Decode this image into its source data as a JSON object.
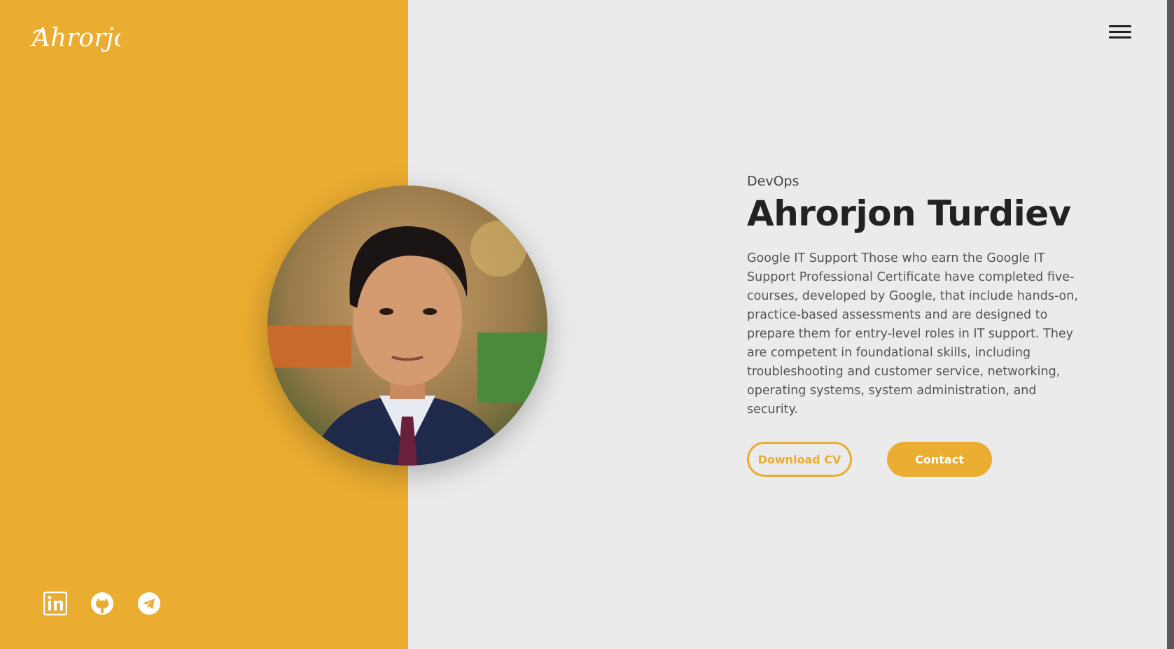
{
  "brand": {
    "logo_text": "Ahrorjon",
    "accent_color": "#eaac31",
    "background_color": "#ebebeb"
  },
  "nav": {
    "menu_icon": "hamburger-menu-icon"
  },
  "hero": {
    "role": "DevOps",
    "name": "Ahrorjon Turdiev",
    "bio": "Google IT Support Those who earn the Google IT Support Professional Certificate have completed five-courses, developed by Google, that include hands-on, practice-based assessments and are designed to prepare them for entry-level roles in IT support. They are competent in foundational skills, including troubleshooting and customer service, networking, operating systems, system administration, and security.",
    "download_label": "Download CV",
    "contact_label": "Contact"
  },
  "socials": [
    {
      "icon": "linkedin-icon"
    },
    {
      "icon": "github-icon"
    },
    {
      "icon": "telegram-icon"
    }
  ]
}
